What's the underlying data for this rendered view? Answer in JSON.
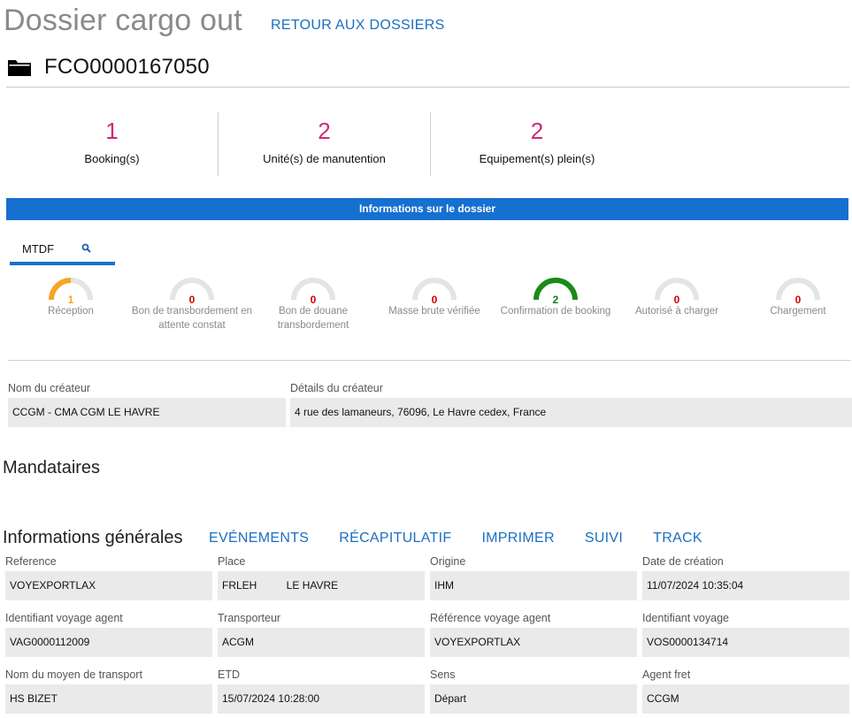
{
  "header": {
    "title": "Dossier cargo out",
    "back_link": "RETOUR AUX DOSSIERS",
    "dossier_id": "FCO0000167050"
  },
  "stats": [
    {
      "value": "1",
      "label": "Booking(s)"
    },
    {
      "value": "2",
      "label": "Unité(s) de manutention"
    },
    {
      "value": "2",
      "label": "Equipement(s) plein(s)"
    }
  ],
  "info_bar": "Informations sur le dossier",
  "tab": {
    "label": "MTDF"
  },
  "gauges": [
    {
      "value": "1",
      "label": "Réception",
      "fill": 0.5,
      "color": "#f5a623",
      "value_color": "#f5a623"
    },
    {
      "value": "0",
      "label": "Bon de transbordement en attente constat",
      "fill": 0,
      "color": "#e6e6e6",
      "value_color": "#d00000"
    },
    {
      "value": "0",
      "label": "Bon de douane transbordement",
      "fill": 0,
      "color": "#e6e6e6",
      "value_color": "#d00000"
    },
    {
      "value": "0",
      "label": "Masse brute vérifiée",
      "fill": 0,
      "color": "#e6e6e6",
      "value_color": "#d00000"
    },
    {
      "value": "2",
      "label": "Confirmation de booking",
      "fill": 1,
      "color": "#1a8a1a",
      "value_color": "#1a7a1a"
    },
    {
      "value": "0",
      "label": "Autorisé à charger",
      "fill": 0,
      "color": "#e6e6e6",
      "value_color": "#d00000"
    },
    {
      "value": "0",
      "label": "Chargement",
      "fill": 0,
      "color": "#e6e6e6",
      "value_color": "#d00000"
    }
  ],
  "creator": {
    "name_label": "Nom du créateur",
    "name_value": "CCGM - CMA CGM LE HAVRE",
    "details_label": "Détails du créateur",
    "details_value": "4 rue des lamaneurs, 76096, Le Havre cedex, France"
  },
  "mandataires_title": "Mandataires",
  "general": {
    "title": "Informations générales",
    "links": [
      "EVÉNEMENTS",
      "RÉCAPITULATIF",
      "IMPRIMER",
      "SUIVI",
      "TRACK"
    ],
    "fields": [
      {
        "label": "Reference",
        "value": "VOYEXPORTLAX"
      },
      {
        "label": "Place",
        "value": "FRLEH          LE HAVRE"
      },
      {
        "label": "Origine",
        "value": "IHM"
      },
      {
        "label": "Date de création",
        "value": "11/07/2024 10:35:04"
      },
      {
        "label": "Identifiant voyage agent",
        "value": "VAG0000112009"
      },
      {
        "label": "Transporteur",
        "value": "ACGM"
      },
      {
        "label": "Référence voyage agent",
        "value": "VOYEXPORTLAX"
      },
      {
        "label": "Identifiant voyage",
        "value": "VOS0000134714"
      },
      {
        "label": "Nom du moyen de transport",
        "value": "HS BIZET"
      },
      {
        "label": "ETD",
        "value": "15/07/2024 10:28:00"
      },
      {
        "label": "Sens",
        "value": "Départ"
      },
      {
        "label": "Agent fret",
        "value": "CCGM"
      }
    ]
  }
}
